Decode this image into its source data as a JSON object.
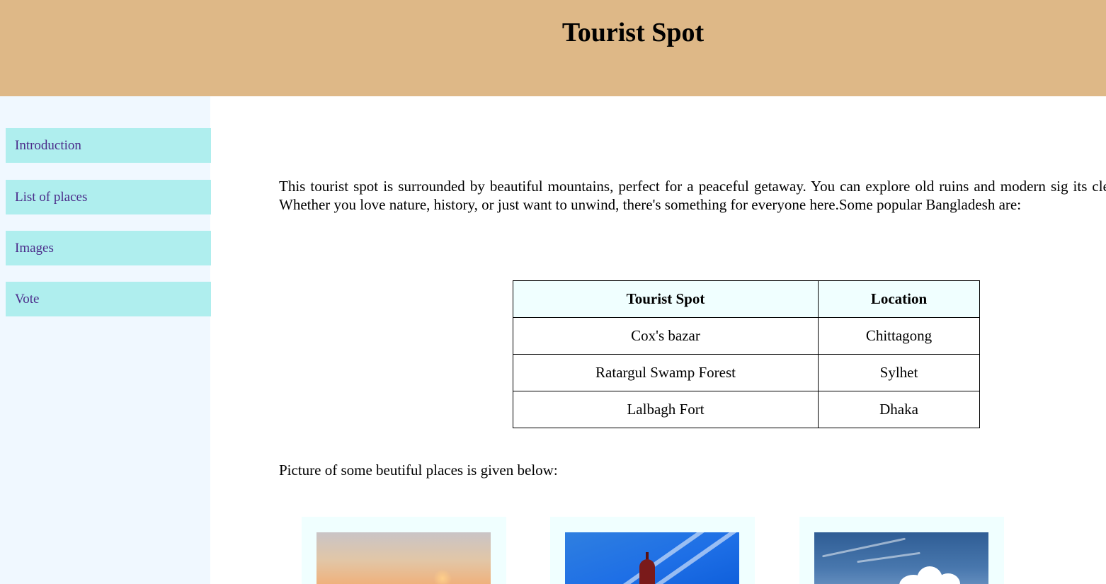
{
  "header": {
    "title": "Tourist Spot"
  },
  "sidebar": {
    "items": [
      {
        "label": "Introduction"
      },
      {
        "label": "List of places"
      },
      {
        "label": "Images"
      },
      {
        "label": "Vote"
      }
    ]
  },
  "main": {
    "intro": "This tourist spot is surrounded by beautiful mountains, perfect for a peaceful getaway. You can explore old ruins and modern sig its clear beaches. Whether you love nature, history, or just want to unwind, there's something for everyone here.Some popular Bangladesh are:",
    "table": {
      "headers": [
        "Tourist Spot",
        "Location"
      ],
      "rows": [
        [
          "Cox's bazar",
          "Chittagong"
        ],
        [
          "Ratargul Swamp Forest",
          "Sylhet"
        ],
        [
          "Lalbagh Fort",
          "Dhaka"
        ]
      ]
    },
    "caption": "Picture of some beutiful places is given below:"
  },
  "colors": {
    "header_bg": "#deb887",
    "sidebar_bg": "#f0f8ff",
    "nav_item_bg": "#afeeee",
    "nav_text": "#4b2c8a",
    "table_header_bg": "#f0ffff",
    "card_bg": "#f0ffff"
  }
}
